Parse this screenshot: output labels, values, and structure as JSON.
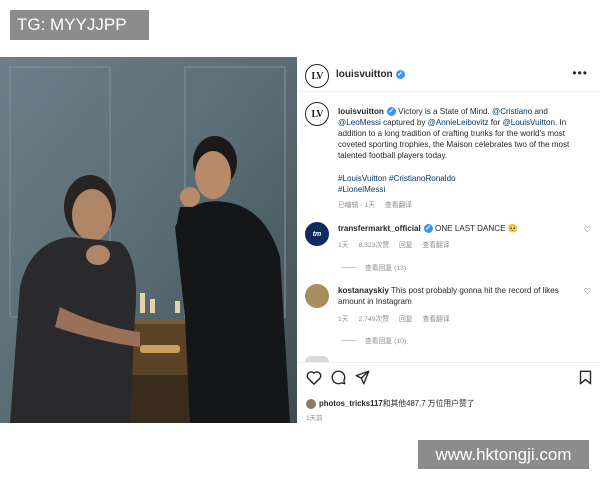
{
  "badge": {
    "text": "TG: MYYJJPP"
  },
  "watermark": {
    "text": "www.hktongji.com"
  },
  "post": {
    "account": "louisvuitton",
    "avatar_monogram": "LV",
    "more_icon": "more-horizontal-icon",
    "caption": {
      "user": "louisvuitton",
      "text_1": "Victory is a State of Mind.",
      "mention_1": "@Cristiano",
      "text_2": "and",
      "mention_2": "@LeoMessi",
      "text_3": "captured by",
      "mention_3": "@AnnieLeibovitz",
      "text_4": "for",
      "mention_4": "@LouisVuitton.",
      "text_5": "In addition to a long tradition of crafting trunks for the world's most coveted sporting trophies, the Maison celebrates two of the most talented football players today."
    },
    "hashtags": [
      "#LouisVuitton",
      "#CristianoRonaldo",
      "#LionelMessi"
    ],
    "caption_meta": {
      "edited_time": "已编辑 · 1天",
      "translate": "查看翻译"
    },
    "comments": [
      {
        "user": "transfermarkt_official",
        "avatar_text": "tm",
        "text": "ONE LAST DANCE 🥺",
        "time": "1天",
        "likes": "8,323次赞",
        "reply": "回复",
        "translate": "查看翻译",
        "view_replies": "查看回复 (13)"
      },
      {
        "user": "kostanayskiy",
        "avatar_text": "",
        "text": "This post probably gonna hit the record of likes amount in Instagram",
        "time": "1天",
        "likes": "2,749次赞",
        "reply": "回复",
        "translate": "查看翻译",
        "view_replies": "查看回复 (10)"
      }
    ],
    "likes_line": {
      "user": "photos_tricks117",
      "rest": "和其他487.7 万位用户赞了"
    },
    "post_time": "1天前"
  },
  "colors": {
    "link": "#00376b",
    "verified": "#3897f0",
    "badge_bg": "#8c8c8c",
    "muted_text": "#8e8e8e"
  }
}
